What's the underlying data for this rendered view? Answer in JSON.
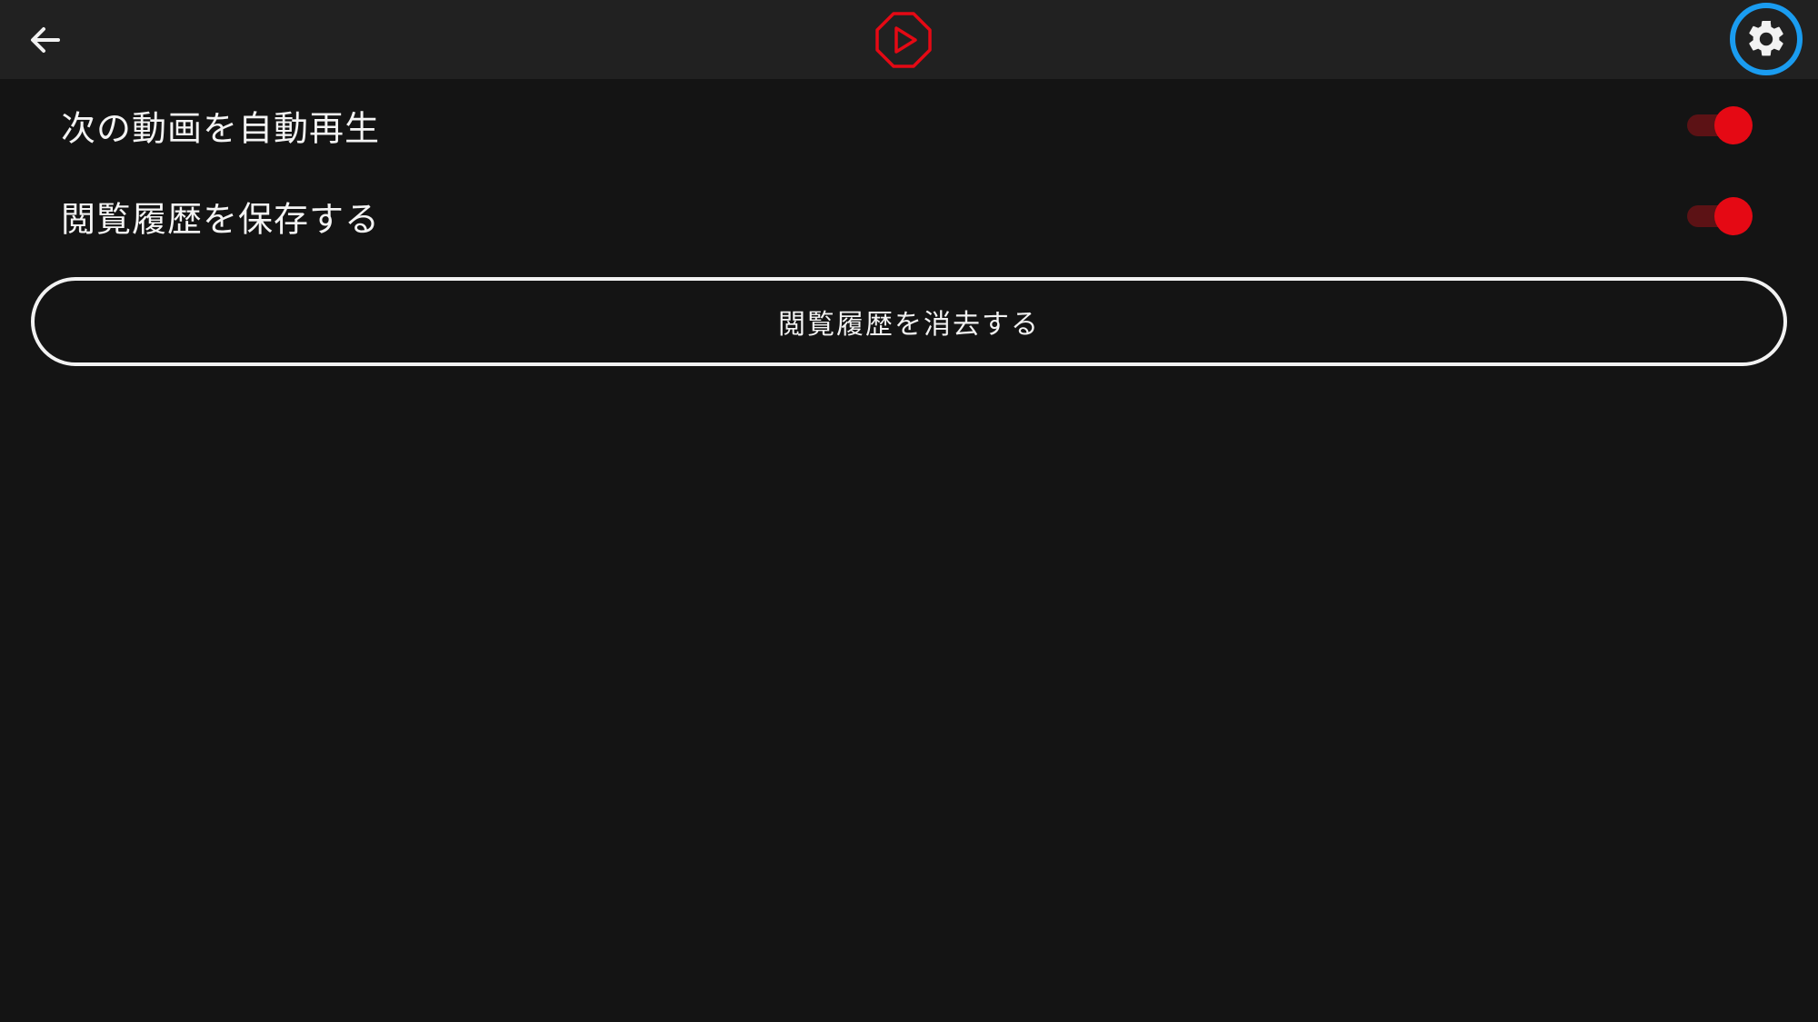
{
  "topbar": {
    "back_icon": "arrow-left-icon",
    "logo_icon": "play-octagon-logo-icon",
    "settings_icon": "gear-icon"
  },
  "settings": [
    {
      "label": "次の動画を自動再生",
      "enabled": true
    },
    {
      "label": "閲覧履歴を保存する",
      "enabled": true
    }
  ],
  "clear_history_button": {
    "label": "閲覧履歴を消去する"
  },
  "colors": {
    "background": "#141414",
    "topbar": "#212121",
    "accent_red": "#e50914",
    "toggle_track_on": "#5c1215",
    "focus_ring": "#1a9cf0",
    "text": "#f2f2f2"
  }
}
